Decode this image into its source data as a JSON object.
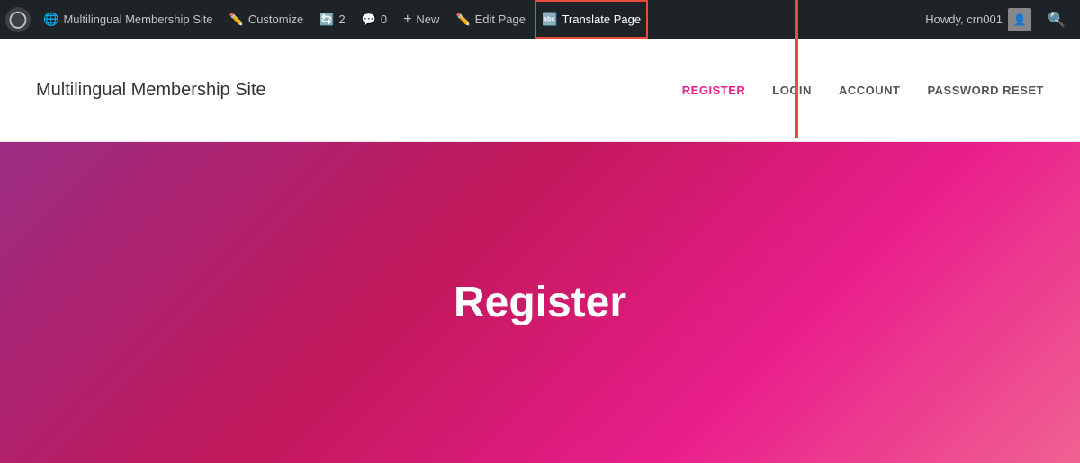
{
  "adminBar": {
    "wpLogo": "W",
    "siteTitle": "Multilingual Membership Site",
    "customize": "Customize",
    "updates": "2",
    "comments": "0",
    "new": "New",
    "editPage": "Edit Page",
    "translatePage": "Translate Page",
    "user": "Howdy, crn001",
    "searchIcon": "🔍"
  },
  "siteHeader": {
    "title": "Multilingual Membership Site",
    "nav": [
      {
        "label": "REGISTER",
        "active": true
      },
      {
        "label": "LOGIN",
        "active": false
      },
      {
        "label": "ACCOUNT",
        "active": false
      },
      {
        "label": "PASSWORD RESET",
        "active": false
      }
    ]
  },
  "hero": {
    "title": "Register"
  },
  "colors": {
    "adminBg": "#1d2327",
    "activeOutline": "#e74c3c",
    "heroGradientStart": "#9b2d82",
    "heroGradientEnd": "#f06292",
    "navActive": "#e91e8c"
  }
}
